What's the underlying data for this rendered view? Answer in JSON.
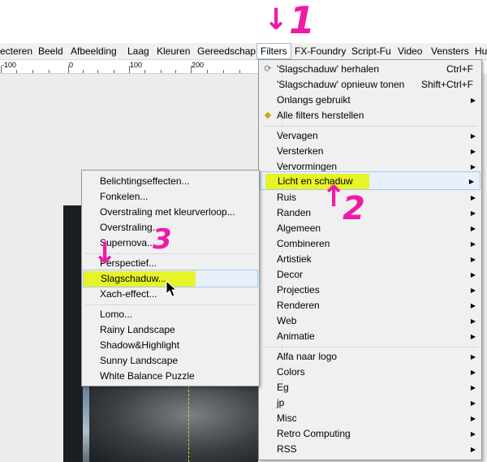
{
  "menubar": {
    "items": [
      {
        "label": "ecteren"
      },
      {
        "label": "Beeld"
      },
      {
        "label": "Afbeelding"
      },
      {
        "label": "Laag"
      },
      {
        "label": "Kleuren"
      },
      {
        "label": "Gereedschap"
      },
      {
        "label": "Filters"
      },
      {
        "label": "FX-Foundry"
      },
      {
        "label": "Script-Fu"
      },
      {
        "label": "Video"
      },
      {
        "label": "Vensters"
      },
      {
        "label": "Hu"
      }
    ]
  },
  "ruler": {
    "labels": [
      "-100",
      "0",
      "100",
      "200"
    ]
  },
  "filters_menu": {
    "top": [
      {
        "label": "'Slagschaduw' herhalen",
        "shortcut": "Ctrl+F",
        "icon": "repeat-icon"
      },
      {
        "label": "'Slagschaduw' opnieuw tonen",
        "shortcut": "Shift+Ctrl+F",
        "icon": ""
      },
      {
        "label": "Onlangs gebruikt",
        "submenu": true
      },
      {
        "label": "Alle filters herstellen",
        "icon": "reset-icon"
      }
    ],
    "groups": [
      {
        "label": "Vervagen"
      },
      {
        "label": "Versterken"
      },
      {
        "label": "Vervormingen"
      },
      {
        "label": "Licht en schaduw"
      },
      {
        "label": "Ruis"
      },
      {
        "label": "Randen"
      },
      {
        "label": "Algemeen"
      },
      {
        "label": "Combineren"
      },
      {
        "label": "Artistiek"
      },
      {
        "label": "Decor"
      },
      {
        "label": "Projecties"
      },
      {
        "label": "Renderen"
      },
      {
        "label": "Web"
      },
      {
        "label": "Animatie"
      }
    ],
    "extra": [
      {
        "label": "Alfa naar logo"
      },
      {
        "label": "Colors"
      },
      {
        "label": "Eg"
      },
      {
        "label": "jp"
      },
      {
        "label": "Misc"
      },
      {
        "label": "Retro Computing"
      },
      {
        "label": "RSS"
      }
    ]
  },
  "light_shadow_submenu": {
    "group1": [
      {
        "label": "Belichtingseffecten..."
      },
      {
        "label": "Fonkelen..."
      },
      {
        "label": "Overstraling met kleurverloop..."
      },
      {
        "label": "Overstraling..."
      },
      {
        "label": "Supernova..."
      }
    ],
    "group2": [
      {
        "label": "Perspectief..."
      },
      {
        "label": "Slagschaduw..."
      },
      {
        "label": "Xach-effect..."
      }
    ],
    "group3": [
      {
        "label": "Lomo..."
      },
      {
        "label": "Rainy Landscape"
      },
      {
        "label": "Shadow&Highlight"
      },
      {
        "label": "Sunny Landscape"
      },
      {
        "label": "White Balance Puzzle"
      }
    ]
  },
  "annotations": {
    "step1": "1",
    "step2": "2",
    "step3": "3",
    "arrow_down": "↓",
    "arrow_up": "↑"
  },
  "colors": {
    "annotation": "#f01aa8",
    "highlight": "#e6f400"
  }
}
